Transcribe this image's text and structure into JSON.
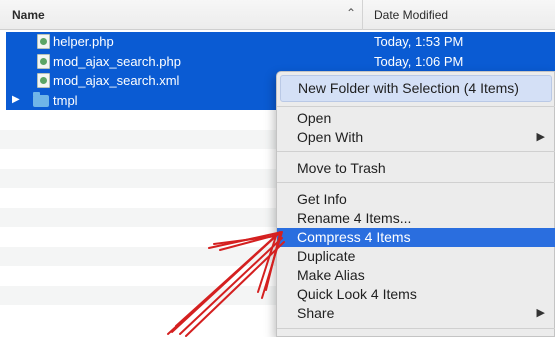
{
  "columns": {
    "name": "Name",
    "date_modified": "Date Modified"
  },
  "files": [
    {
      "name": "helper.php",
      "date": "Today, 1:53 PM",
      "type": "file"
    },
    {
      "name": "mod_ajax_search.php",
      "date": "Today, 1:06 PM",
      "type": "file"
    },
    {
      "name": "mod_ajax_search.xml",
      "date": "",
      "type": "file"
    },
    {
      "name": "tmpl",
      "date": "",
      "type": "folder"
    }
  ],
  "context_menu": {
    "new_folder": "New Folder with Selection (4 Items)",
    "open": "Open",
    "open_with": "Open With",
    "move_to_trash": "Move to Trash",
    "get_info": "Get Info",
    "rename": "Rename 4 Items...",
    "compress": "Compress 4 Items",
    "duplicate": "Duplicate",
    "make_alias": "Make Alias",
    "quick_look": "Quick Look 4 Items",
    "share": "Share"
  },
  "colors": {
    "selection": "#0a5bd3",
    "menu_highlight": "#2a6edf",
    "annotation": "#d42020"
  },
  "icons": {
    "sort": "chevron-up-icon",
    "submenu": "triangle-right-icon",
    "disclosure": "triangle-right-icon"
  }
}
